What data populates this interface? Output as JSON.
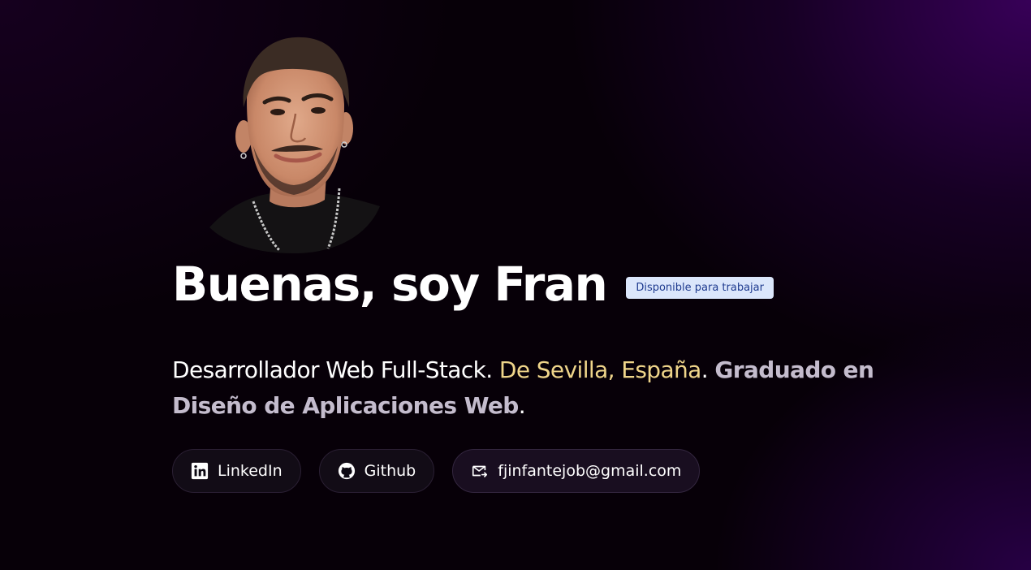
{
  "profile": {
    "avatar_alt": "Fran",
    "title": "Buenas, soy Fran",
    "badge": "Disponible para trabajar",
    "subtitle": {
      "role": "Desarrollador Web Full-Stack.",
      "location": "De Sevilla, España",
      "period1": ".",
      "degree": "Graduado en Diseño de Aplicaciones Web",
      "period2": "."
    }
  },
  "links": [
    {
      "label": "LinkedIn",
      "icon": "linkedin-icon"
    },
    {
      "label": "Github",
      "icon": "github-icon"
    },
    {
      "label": "fjinfantejob@gmail.com",
      "icon": "mail-icon"
    }
  ],
  "colors": {
    "background": "#070008",
    "accent_purple": "#3a005c",
    "location_yellow": "#efd58a",
    "degree_gray": "#c4bccd",
    "badge_bg": "#dbe6fb",
    "badge_text": "#1f3b8f"
  }
}
